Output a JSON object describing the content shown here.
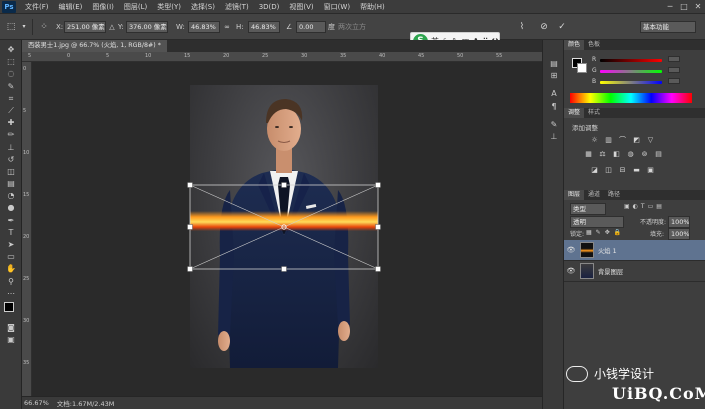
{
  "app": {
    "logo": "Ps"
  },
  "menu": [
    "文件(F)",
    "编辑(E)",
    "图像(I)",
    "图层(L)",
    "类型(Y)",
    "选择(S)",
    "滤镜(T)",
    "3D(D)",
    "视图(V)",
    "窗口(W)",
    "帮助(H)"
  ],
  "window_controls": [
    "─",
    "□",
    "✕"
  ],
  "options": {
    "x_label": "X:",
    "x_value": "251.00 像素",
    "y_label": "Y:",
    "y_value": "376.00 像素",
    "w_label": "W:",
    "w_value": "46.83%",
    "h_label": "H:",
    "h_value": "46.83%",
    "angle_label": "∠",
    "angle_value": "0.00",
    "interp_label": "度",
    "interp_mode": "两次立方",
    "ws_value": "基本功能"
  },
  "ime": {
    "logo": "S",
    "lang": "英"
  },
  "document_tab": "西装男士1.jpg @ 66.7% (火焰, 1, RGB/8#) *",
  "rulers": {
    "top_ticks": [
      "5",
      "0",
      "5",
      "10",
      "15",
      "20",
      "25",
      "30",
      "35",
      "40",
      "45",
      "50",
      "55"
    ],
    "left_ticks": [
      "0",
      "5",
      "10",
      "15",
      "20",
      "25",
      "30",
      "35"
    ]
  },
  "status": {
    "zoom": "66.67%",
    "doc": "文档:1.67M/2.43M"
  },
  "panels": {
    "color_tabs": [
      "颜色",
      "色板"
    ],
    "color_slider_labels": [
      "R",
      "G",
      "B"
    ],
    "color_values": [
      "",
      "",
      ""
    ],
    "color_accent": "#ff5a3c",
    "adjust_tabs": [
      "调整",
      "样式"
    ],
    "adjust_title": "添加调整",
    "layers_tabs": [
      "图层",
      "通道",
      "路径"
    ],
    "kind_label": "类型",
    "blend_mode": "透明",
    "opacity_label": "不透明度:",
    "opacity_value": "100%",
    "lock_label": "锁定:",
    "fill_label": "填充:",
    "fill_value": "100%",
    "layers": [
      {
        "name": "火焰 1",
        "selected": true
      },
      {
        "name": "背景图层",
        "selected": false
      }
    ]
  },
  "watermark": {
    "caption": "小钱学设计",
    "site": "UiBQ.CoM"
  }
}
